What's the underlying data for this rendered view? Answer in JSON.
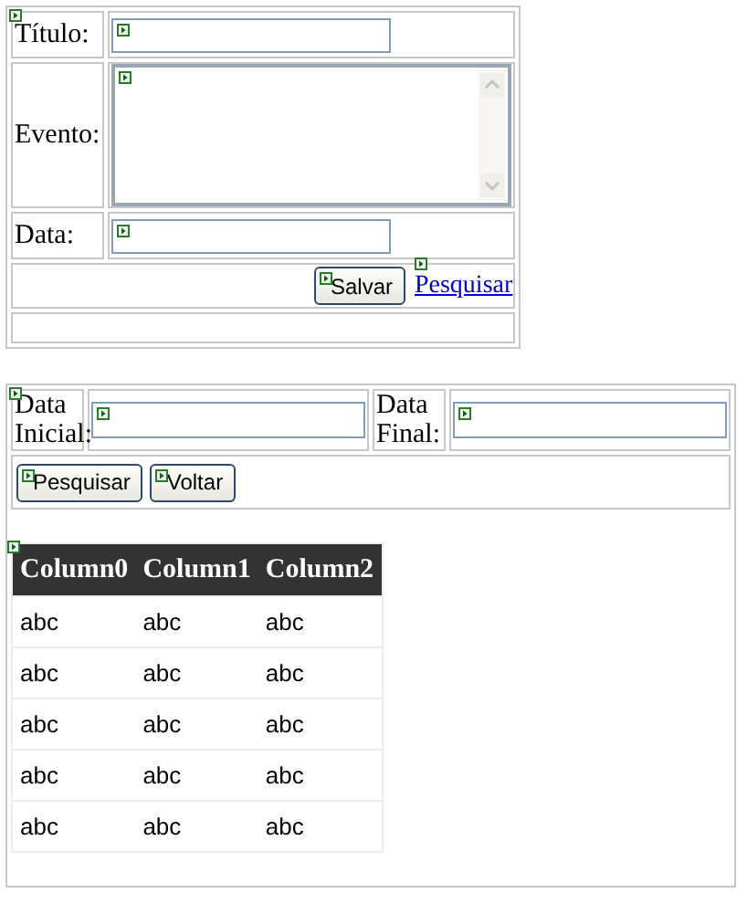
{
  "form": {
    "fields": [
      {
        "label": "Título:",
        "kind": "input"
      },
      {
        "label": "Evento:",
        "kind": "textarea"
      },
      {
        "label": "Data:",
        "kind": "input"
      }
    ],
    "actions": [
      {
        "label": "Salvar",
        "kind": "button"
      },
      {
        "label": "Pesquisar",
        "kind": "link"
      }
    ]
  },
  "search": {
    "fields": [
      {
        "label": "Data Inicial:"
      },
      {
        "label": "Data Final:"
      }
    ],
    "buttons": [
      "Pesquisar",
      "Voltar"
    ]
  },
  "grid": {
    "columns": [
      "Column0",
      "Column1",
      "Column2"
    ],
    "rows": [
      [
        "abc",
        "abc",
        "abc"
      ],
      [
        "abc",
        "abc",
        "abc"
      ],
      [
        "abc",
        "abc",
        "abc"
      ],
      [
        "abc",
        "abc",
        "abc"
      ],
      [
        "abc",
        "abc",
        "abc"
      ]
    ]
  }
}
